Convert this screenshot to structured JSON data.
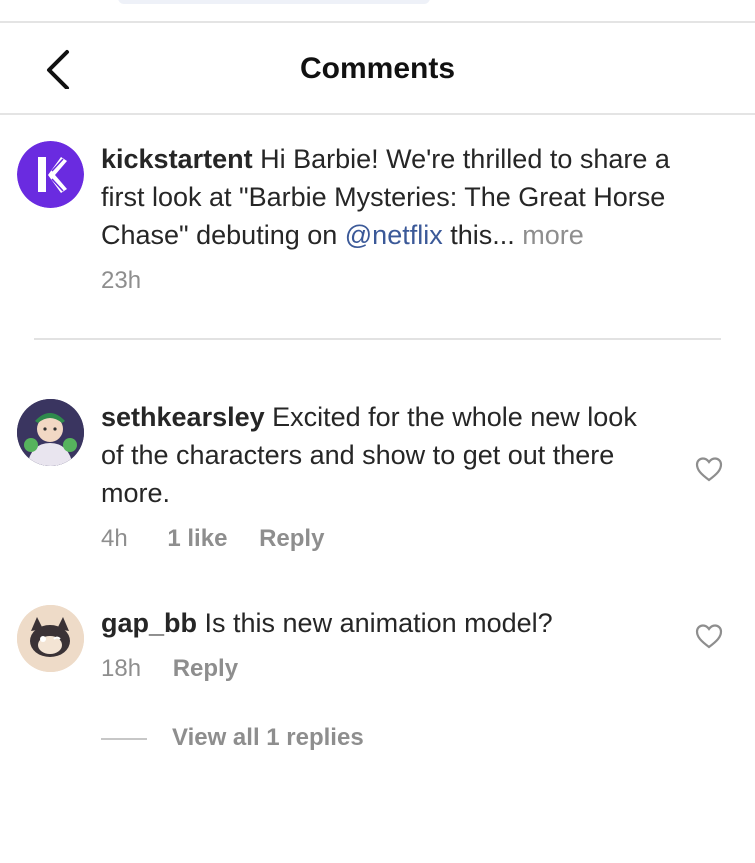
{
  "header": {
    "title": "Comments",
    "back_icon": "chevron-left-icon"
  },
  "caption": {
    "username": "kickstartent",
    "text_before": " Hi Barbie! We're thrilled to share a first look at \"Barbie Mysteries: The Great Horse Chase\" debuting on ",
    "mention": "@netflix",
    "text_after": " this...",
    "more": " more",
    "time": "23h",
    "avatar_color": "#6a2be0"
  },
  "comments": [
    {
      "username": "sethkearsley",
      "text": " Excited for the whole new look of the characters and show to get out there more.",
      "time": "4h",
      "likes": "1 like",
      "reply": "Reply"
    },
    {
      "username": "gap_bb",
      "text": " Is this new animation model?",
      "time": "18h",
      "reply": "Reply",
      "view_replies": "View all 1 replies"
    }
  ],
  "colors": {
    "accent_link": "#3b5998",
    "muted": "#8e8e8e",
    "text": "#262626"
  }
}
